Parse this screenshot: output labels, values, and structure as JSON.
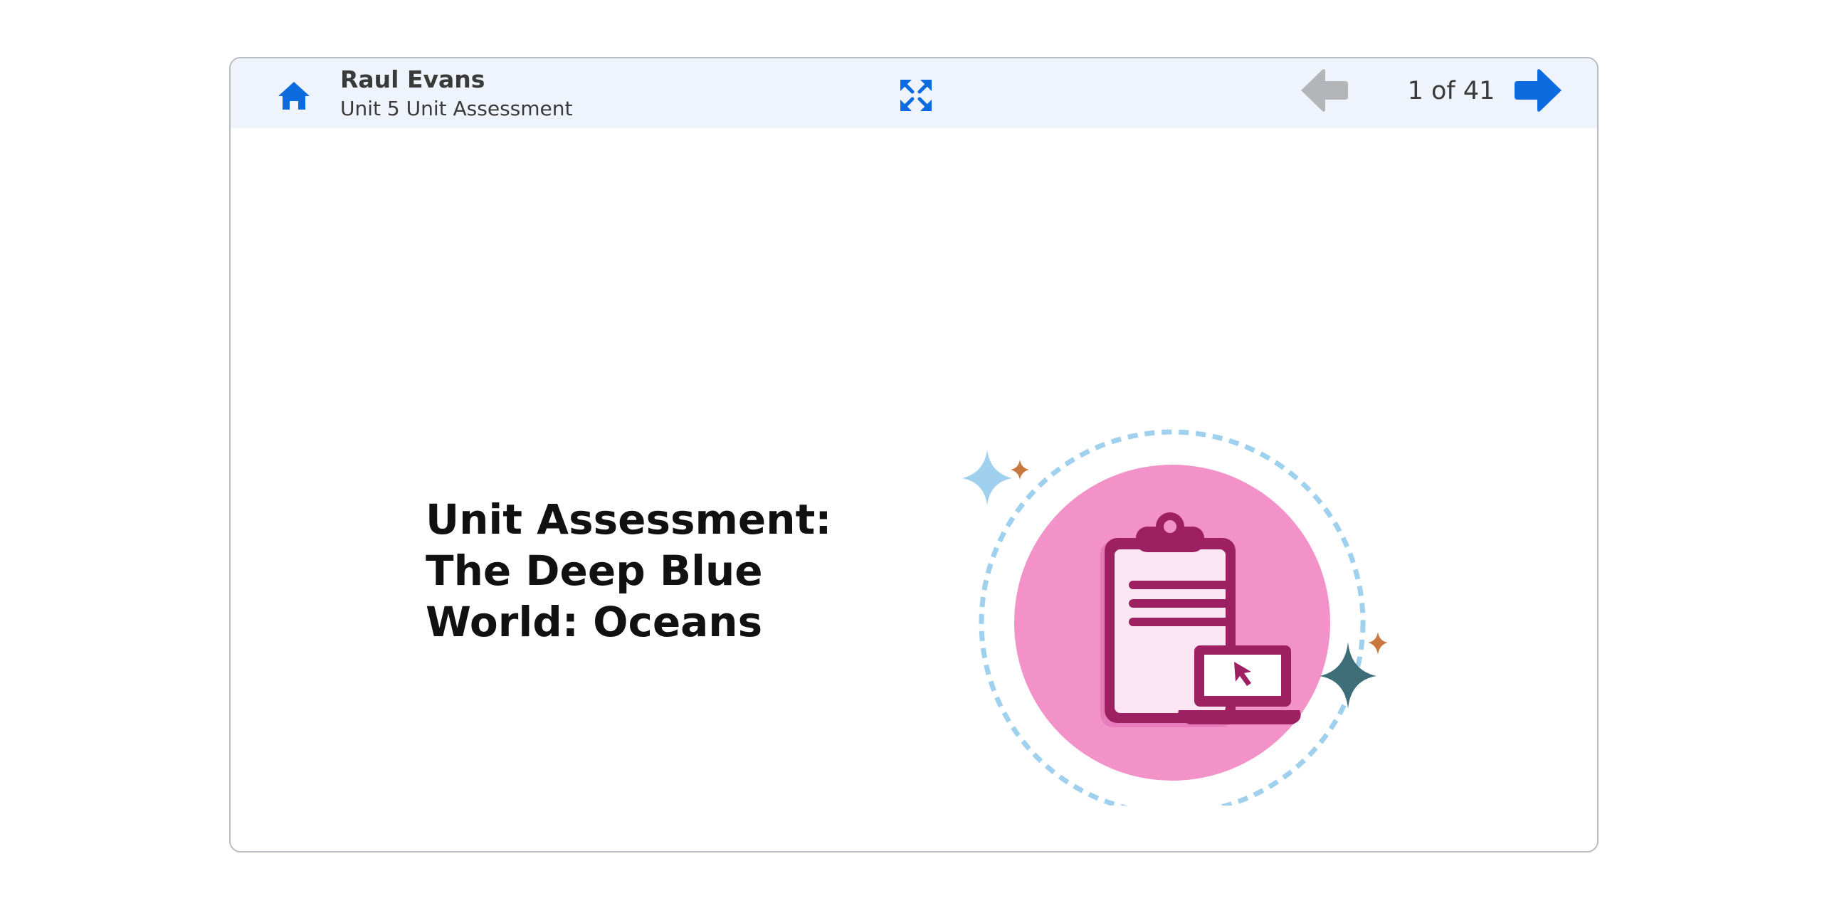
{
  "header": {
    "user_name": "Raul Evans",
    "assessment_title": "Unit 5 Unit Assessment",
    "page_indicator": "1 of 41"
  },
  "icons": {
    "home": "home-icon",
    "expand": "fullscreen-expand-icon",
    "prev": "arrow-left-icon",
    "next": "arrow-right-icon",
    "illustration": "clipboard-laptop-icon"
  },
  "slide": {
    "title": "Unit Assessment: The Deep Blue World: Oceans"
  },
  "colors": {
    "accent_blue": "#0b6bdf",
    "disabled_gray": "#b3b5b9",
    "topbar_bg": "#eff3fb",
    "circle_pink": "#f292c8",
    "icon_magenta": "#9c2062",
    "dashed_ring": "#9fd0ee",
    "sparkle_orange": "#c8773f",
    "sparkle_teal": "#3e6e78"
  }
}
